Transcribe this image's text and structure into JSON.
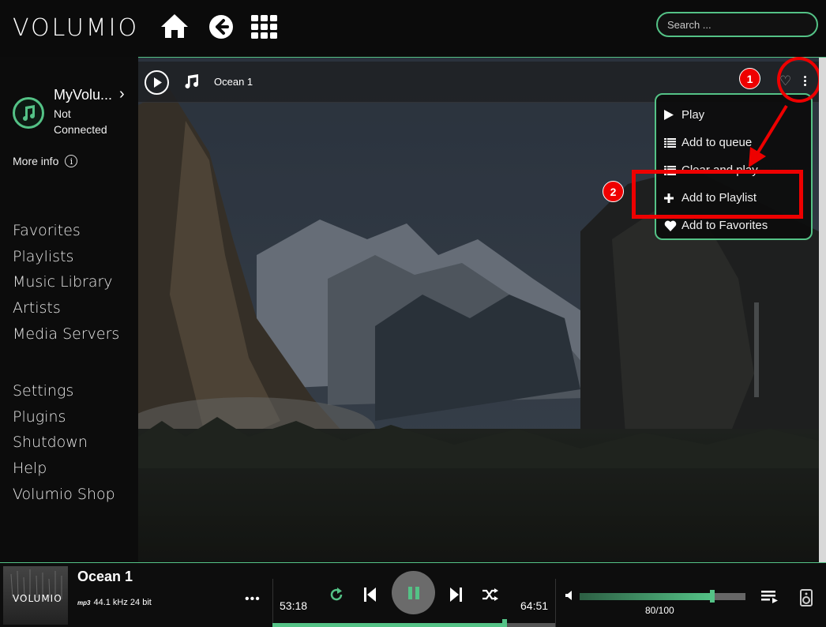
{
  "header": {
    "logo_text": "VOLUMIO",
    "nav": [
      {
        "name": "home-icon"
      },
      {
        "name": "back-arrow-icon"
      },
      {
        "name": "grid-menu-icon"
      }
    ],
    "search_placeholder": "Search ...",
    "accent": "#54c286"
  },
  "sidebar": {
    "device_name": "MyVolu...",
    "device_status": "Not Connected",
    "more_info": "More info",
    "menu_primary": [
      "Favorites",
      "Playlists",
      "Music Library",
      "Artists",
      "Media Servers"
    ],
    "menu_secondary": [
      "Settings",
      "Plugins",
      "Shutdown",
      "Help",
      "Volumio Shop"
    ]
  },
  "track_row": {
    "title": "Ocean 1"
  },
  "context_menu": {
    "items": [
      {
        "label": "Play",
        "icon": "play-icon"
      },
      {
        "label": "Add to queue",
        "icon": "list-icon"
      },
      {
        "label": "Clear and play",
        "icon": "list-icon"
      },
      {
        "label": "Add to Playlist",
        "icon": "plus-icon"
      },
      {
        "label": "Add to Favorites",
        "icon": "heart-icon"
      }
    ]
  },
  "annotations": {
    "step1": "1",
    "step2": "2",
    "color": "#e00000"
  },
  "player": {
    "title": "Ocean 1",
    "format_badge": "mp3",
    "format": "44.1 kHz 24 bit",
    "more": "•••",
    "album_logo": "VOLUMIO",
    "elapsed": "53:18",
    "total": "64:51",
    "progress_fraction": 0.822,
    "volume_label": "80/100",
    "volume": 80,
    "volume_max": 100
  }
}
